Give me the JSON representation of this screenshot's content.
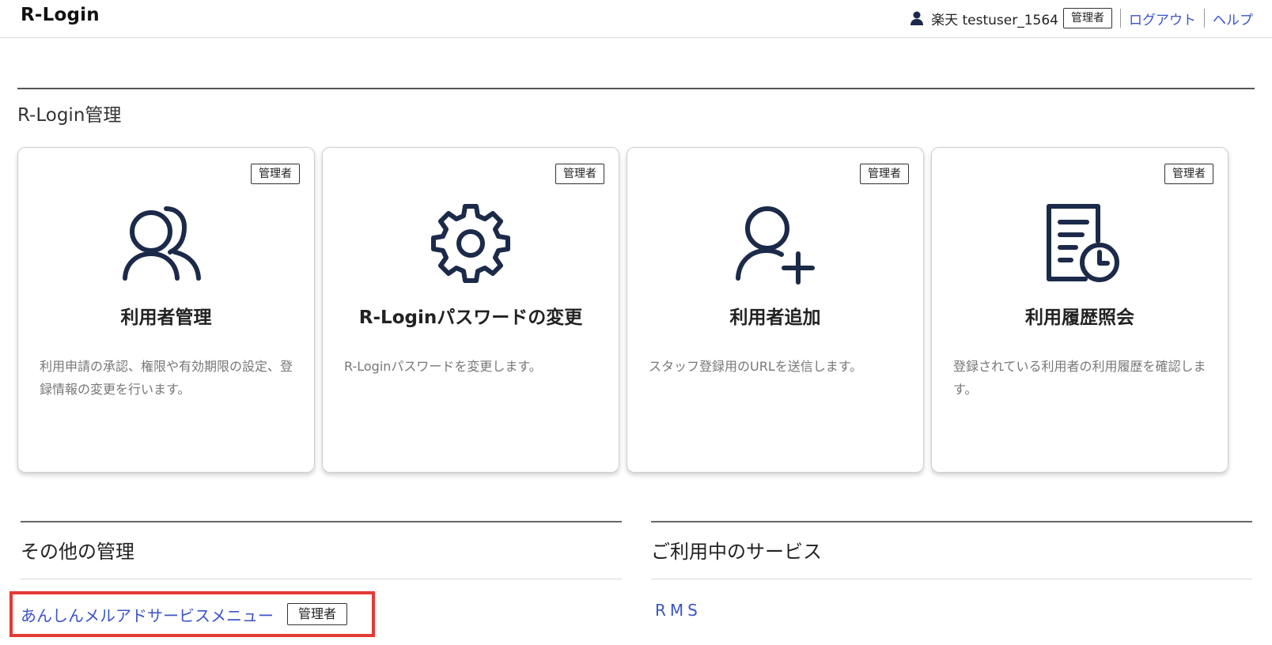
{
  "header": {
    "logo": "R-Login",
    "user_name": "楽天 testuser_1564",
    "role_badge": "管理者",
    "logout": "ログアウト",
    "help": "ヘルプ"
  },
  "section": {
    "title": "R-Login管理"
  },
  "cards": [
    {
      "badge": "管理者",
      "title": "利用者管理",
      "desc": "利用申請の承認、権限や有効期限の設定、登録情報の変更を行います。",
      "icon": "users-icon"
    },
    {
      "badge": "管理者",
      "title": "R-Loginパスワードの変更",
      "desc": "R-Loginパスワードを変更します。",
      "icon": "gear-icon"
    },
    {
      "badge": "管理者",
      "title": "利用者追加",
      "desc": "スタッフ登録用のURLを送信します。",
      "icon": "user-add-icon"
    },
    {
      "badge": "管理者",
      "title": "利用履歴照会",
      "desc": "登録されている利用者の利用履歴を確認します。",
      "icon": "history-document-icon"
    }
  ],
  "other": {
    "title": "その他の管理",
    "link": "あんしんメルアドサービスメニュー",
    "badge": "管理者"
  },
  "services": {
    "title": "ご利用中のサービス",
    "link": "RMS"
  },
  "colors": {
    "icon": "#1c2a4a",
    "link": "#3b55c6",
    "highlight": "#e53935"
  }
}
